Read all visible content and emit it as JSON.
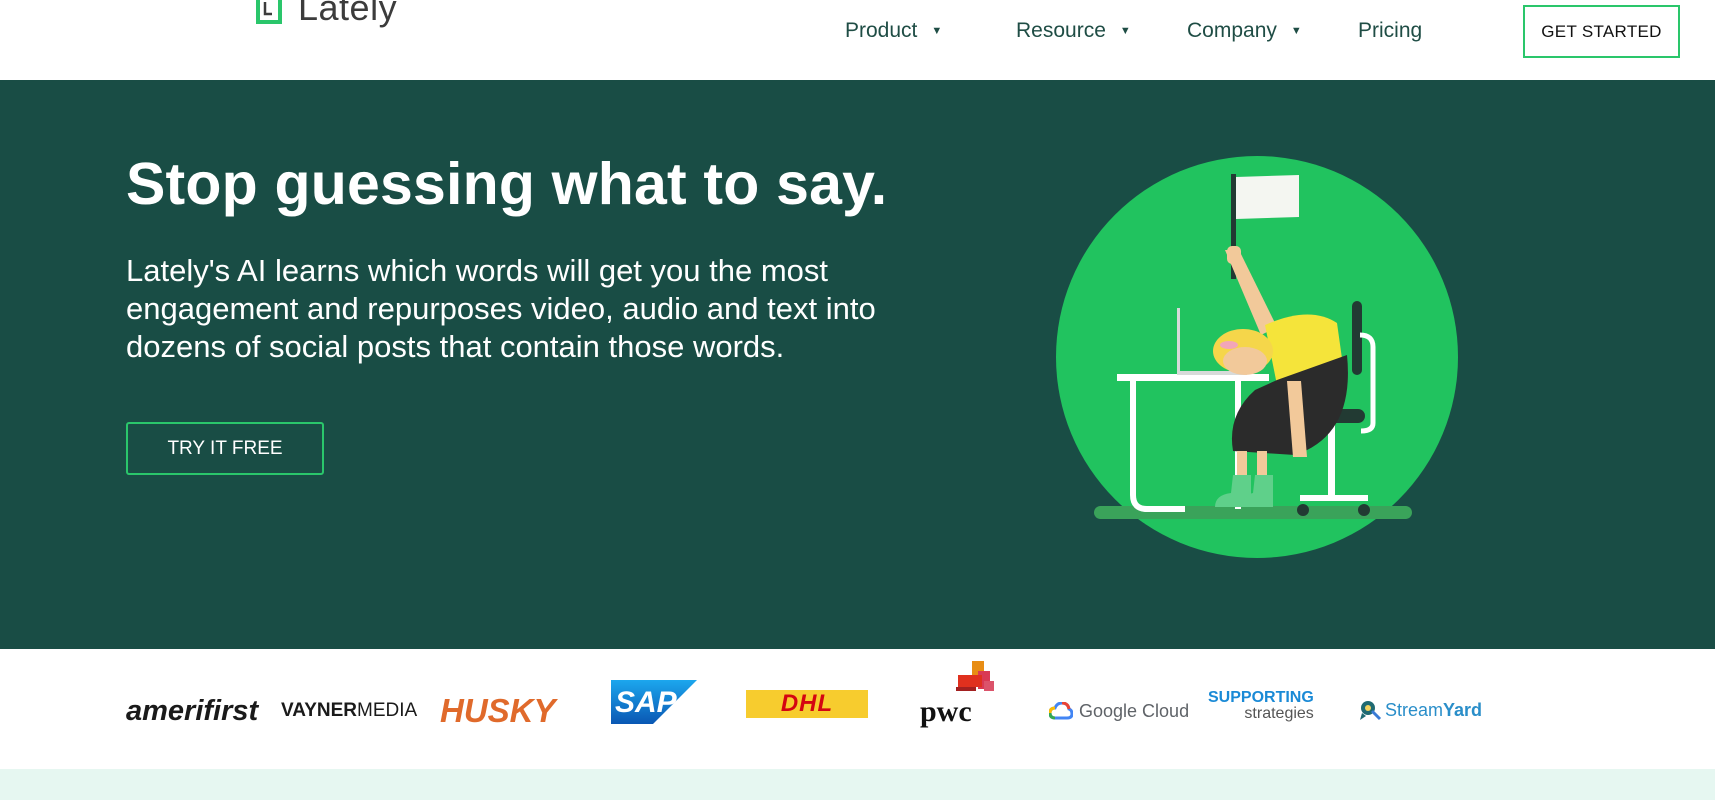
{
  "header": {
    "logo_text": "Lately",
    "nav": [
      {
        "label": "Product",
        "has_dropdown": true
      },
      {
        "label": "Resource",
        "has_dropdown": true
      },
      {
        "label": "Company",
        "has_dropdown": true
      },
      {
        "label": "Pricing",
        "has_dropdown": false
      }
    ],
    "cta_label": "GET STARTED",
    "caret": "▼"
  },
  "hero": {
    "headline": "Stop guessing what to say.",
    "body": "Lately's AI learns which words will get you the most engagement and repurposes video, audio and text into dozens of social posts that contain those words.",
    "cta_label": "TRY IT FREE",
    "illustration_icon": "woman-desk-flag-illustration"
  },
  "logos": {
    "items": [
      "amerifirst",
      "VAYNERMEDIA",
      "HUSKY",
      "SAP",
      "DHL",
      "pwc",
      "Google Cloud",
      "SUPPORTING strategies",
      "StreamYard"
    ],
    "vayner_a": "VAYNER",
    "vayner_b": "MEDIA",
    "supporting_a": "SUPPORTING",
    "supporting_b": "strategies",
    "streamyard_a": "Stream",
    "streamyard_b": "Yard"
  },
  "colors": {
    "hero_bg": "#194d45",
    "accent": "#2ac66b",
    "circle": "#21c35f",
    "strip": "#e6f7f1"
  }
}
